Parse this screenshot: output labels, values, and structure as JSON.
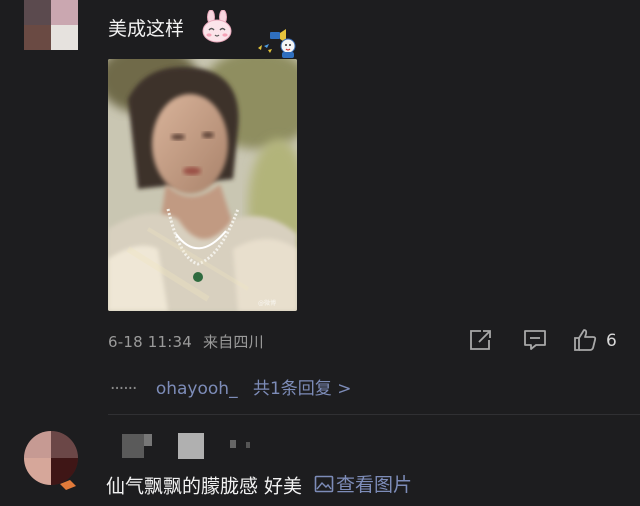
{
  "comment1": {
    "text": "美成这样",
    "date": "6-18 11:34",
    "location": "来自四川",
    "like_count": "6",
    "reply_dots": "······",
    "reply_user": "ohayooh_",
    "reply_summary": "共1条回复 >"
  },
  "comment2": {
    "text": "仙气飘飘的朦胧感 好美",
    "view_image": "查看图片"
  },
  "colors": {
    "background": "#1d1d1f",
    "link": "#7d8cb8",
    "meta": "#9a9a9a"
  }
}
